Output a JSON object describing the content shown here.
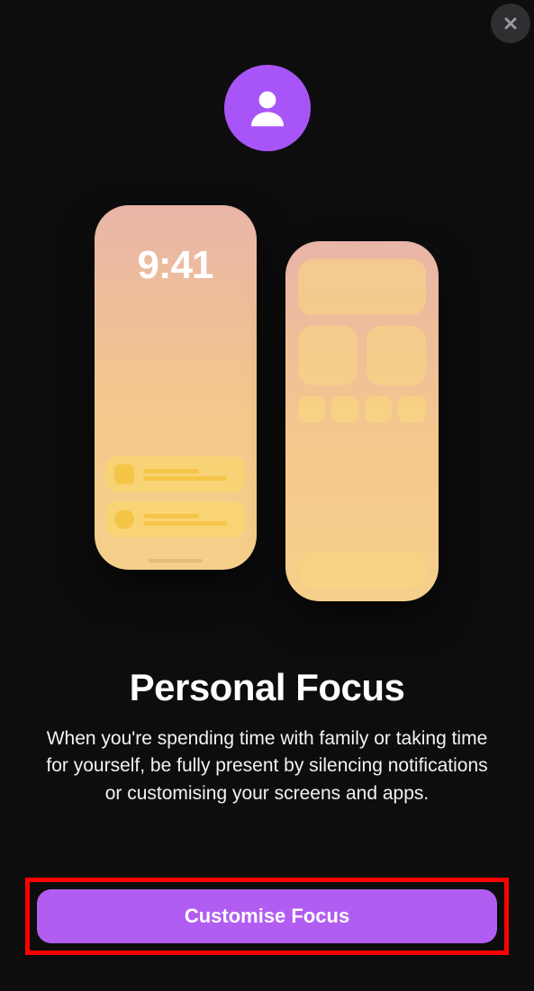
{
  "header": {
    "close_icon": "close"
  },
  "hero": {
    "avatar_icon": "person",
    "clock": "9:41"
  },
  "main": {
    "title": "Personal Focus",
    "description": "When you're spending time with family or taking time for yourself, be fully present by silencing notifications or customising your screens and apps."
  },
  "cta": {
    "label": "Customise Focus"
  },
  "colors": {
    "accent": "#a855f7",
    "cta_bg": "#b25df1",
    "highlight_border": "#ff0000"
  }
}
